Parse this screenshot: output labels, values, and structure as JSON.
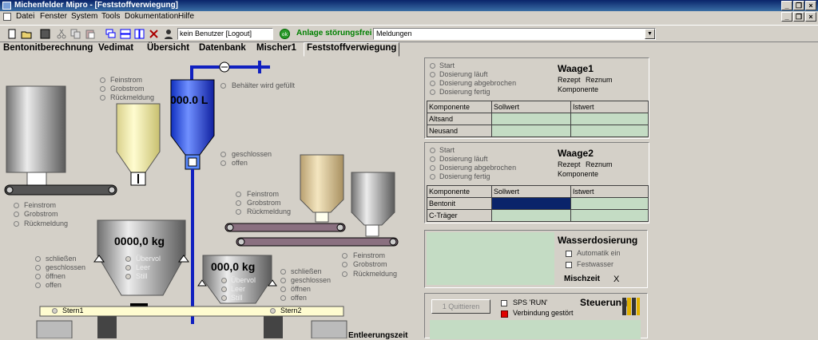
{
  "window": {
    "title": "Michenfelder Mipro - [Feststoffverwiegung]"
  },
  "menu": [
    "Datei",
    "Fenster",
    "System",
    "Tools",
    "Dokumentation",
    "Hilfe"
  ],
  "toolbar": {
    "user": "kein Benutzer [Logout]",
    "status": "Anlage störungsfrei",
    "messages": "Meldungen",
    "status_color": "#008000"
  },
  "tabs": [
    "Bentonitberechnung",
    "Vedimat",
    "Übersicht",
    "Datenbank",
    "Mischer1",
    "Feststoffverwiegung"
  ],
  "plant": {
    "feed_labels": [
      "Feinstrom",
      "Grobstrom",
      "Rückmeldung"
    ],
    "tank_value": "000.0 L",
    "tank_status": "Behälter wird gefüllt",
    "valve_labels": [
      "geschlossen",
      "offen"
    ],
    "belt_labels": [
      "Feinstrom",
      "Grobstrom",
      "Rückmeldung"
    ],
    "scale1_value": "0000,0  kg",
    "scale2_value": "000,0 kg",
    "gate_labels": [
      "schließen",
      "geschlossen",
      "öffnen",
      "offen"
    ],
    "level_labels": [
      "Übervol",
      "Leer",
      "Still"
    ],
    "stern1": "Stern1",
    "stern2": "Stern2",
    "discharge_label": "Entleerungszeit"
  },
  "waage1": {
    "status": [
      "Start",
      "Dosierung läuft",
      "Dosierung abgebrochen",
      "Dosierung fertig"
    ],
    "title": "Waage1",
    "rezept_label": "Rezept",
    "rezept_value": "Reznum",
    "komponente_label": "Komponente",
    "headers": [
      "Komponente",
      "Sollwert",
      "Istwert"
    ],
    "rows": [
      "Altsand",
      "Neusand"
    ]
  },
  "waage2": {
    "status": [
      "Start",
      "Dosierung läuft",
      "Dosierung abgebrochen",
      "Dosierung fertig"
    ],
    "title": "Waage2",
    "rezept_label": "Rezept",
    "rezept_value": "Reznum",
    "komponente_label": "Komponente",
    "headers": [
      "Komponente",
      "Sollwert",
      "Istwert"
    ],
    "rows": [
      "Bentonit",
      "C-Träger"
    ]
  },
  "wasser": {
    "title": "Wasserdosierung",
    "options": [
      "Automatik ein",
      "Festwasser"
    ],
    "mischzeit_label": "Mischzeit",
    "mischzeit_value": "X"
  },
  "steuerung": {
    "quit_button": "Quittieren",
    "sps": "SPS 'RUN'",
    "connection": "Verbindung gestört",
    "title": "Steuerung",
    "error_color": "#e00000"
  }
}
